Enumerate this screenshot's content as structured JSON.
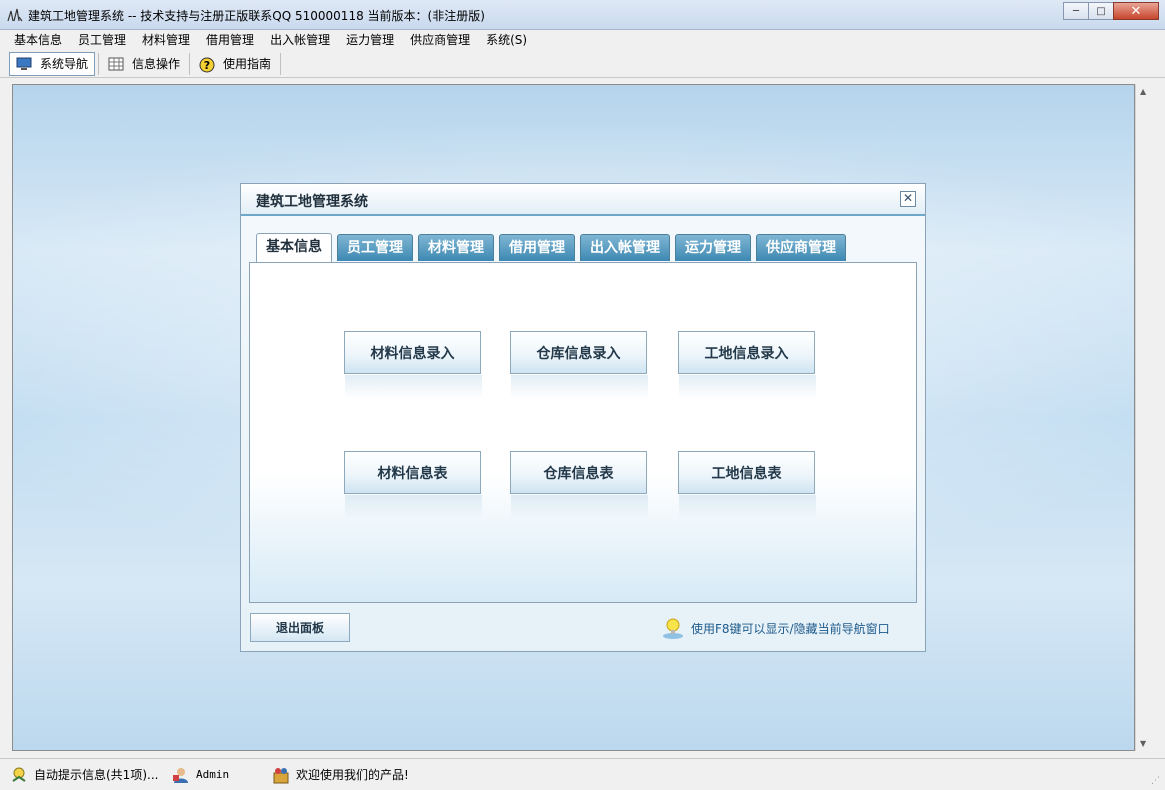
{
  "window": {
    "title": "建筑工地管理系统 -- 技术支持与注册正版联系QQ 510000118    当前版本：(非注册版)",
    "minimize_glyph": "─",
    "maximize_glyph": "□",
    "close_glyph": "✕"
  },
  "menu": {
    "items": [
      "基本信息",
      "员工管理",
      "材料管理",
      "借用管理",
      "出入帐管理",
      "运力管理",
      "供应商管理",
      "系统(S)"
    ]
  },
  "toolbar": {
    "items": [
      {
        "label": "系统导航",
        "icon": "monitor-icon",
        "active": true
      },
      {
        "label": "信息操作",
        "icon": "grid-icon",
        "active": false
      },
      {
        "label": "使用指南",
        "icon": "help-icon",
        "active": false
      }
    ]
  },
  "dialog": {
    "title": "建筑工地管理系统",
    "close_glyph": "✕",
    "tabs": [
      "基本信息",
      "员工管理",
      "材料管理",
      "借用管理",
      "出入帐管理",
      "运力管理",
      "供应商管理"
    ],
    "active_tab": 0,
    "buttons": [
      "材料信息录入",
      "仓库信息录入",
      "工地信息录入",
      "材料信息表",
      "仓库信息表",
      "工地信息表"
    ],
    "exit_label": "退出面板",
    "hint_text": "使用F8键可以显示/隐藏当前导航窗口"
  },
  "statusbar": {
    "notice": "自动提示信息(共1项)...",
    "user": "Admin",
    "welcome": "欢迎使用我们的产品!"
  },
  "colors": {
    "tab_active_bg": "#ffffff",
    "tab_bg": "#3d88b3",
    "accent": "#6fa7c8"
  }
}
